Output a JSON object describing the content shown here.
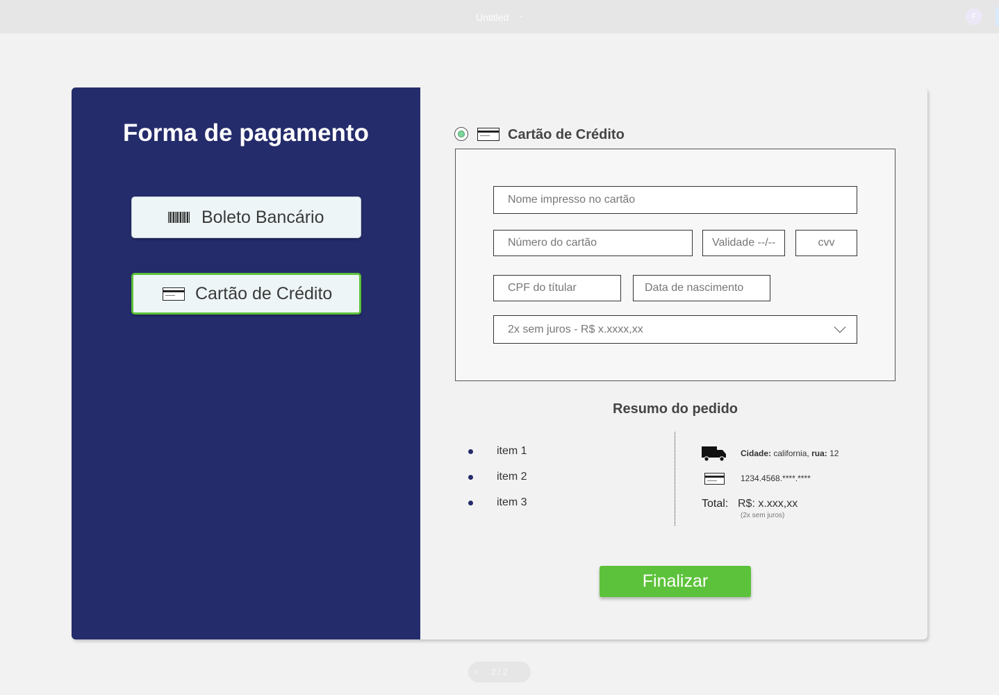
{
  "topbar": {
    "doc_title": "Untitled",
    "caret": "⌄",
    "avatar_initial": "F"
  },
  "left_panel": {
    "title": "Forma de pagamento",
    "methods": [
      {
        "label": "Boleto Bancário",
        "icon": "barcode-icon",
        "selected": false
      },
      {
        "label": "Cartão de Crédito",
        "icon": "credit-card-icon",
        "selected": true
      }
    ]
  },
  "credit_card_section": {
    "title": "Cartão de Crédito",
    "radio_selected": true,
    "fields": {
      "nome_placeholder": "Nome impresso no cartão",
      "numero_placeholder": "Número do cartão",
      "validade_placeholder": "Validade --/--",
      "cvv_placeholder": "cvv",
      "cpf_placeholder": "CPF do títular",
      "nascimento_placeholder": "Data de nascimento",
      "parcelas_value": "2x sem juros - R$ x.xxxx,xx"
    }
  },
  "summary": {
    "title": "Resumo do pedido",
    "items": [
      "item 1",
      "item 2",
      "item 3"
    ],
    "address_city_label": "Cidade:",
    "address_city": "california,",
    "address_street_label": "rua:",
    "address_street": "12",
    "card_number": "1234.4568.****.****",
    "total_label": "Total:",
    "total_value": "R$: x.xxx,xx",
    "total_note": "(2x sem juros)"
  },
  "actions": {
    "finalize_label": "Finalizar"
  },
  "pager": {
    "prev": "‹",
    "text": "2 / 2"
  },
  "colors": {
    "panel": "#252c6b",
    "accent_green": "#5dc23b",
    "background": "#f2f2f2"
  }
}
